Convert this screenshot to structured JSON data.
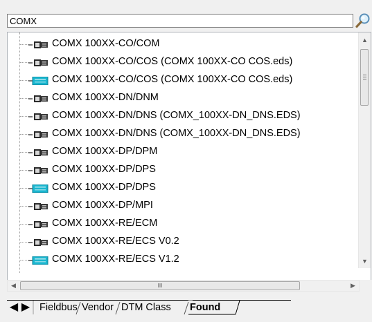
{
  "search": {
    "value": "COMX",
    "button_icon": "magnifier-icon"
  },
  "tree": {
    "items": [
      {
        "label": "COMX 100XX-CO/COM",
        "icon": "device-card-icon",
        "selected": true
      },
      {
        "label": "COMX 100XX-CO/COS (COMX 100XX-CO COS.eds)",
        "icon": "device-card-icon"
      },
      {
        "label": "COMX 100XX-CO/COS (COMX 100XX-CO COS.eds)",
        "icon": "device-card-cyan-icon"
      },
      {
        "label": "COMX 100XX-DN/DNM",
        "icon": "device-card-icon"
      },
      {
        "label": "COMX 100XX-DN/DNS (COMX_100XX-DN_DNS.EDS)",
        "icon": "device-card-icon"
      },
      {
        "label": "COMX 100XX-DN/DNS (COMX_100XX-DN_DNS.EDS)",
        "icon": "device-card-icon"
      },
      {
        "label": "COMX 100XX-DP/DPM",
        "icon": "device-card-icon"
      },
      {
        "label": "COMX 100XX-DP/DPS",
        "icon": "device-card-icon"
      },
      {
        "label": "COMX 100XX-DP/DPS",
        "icon": "device-card-cyan-icon"
      },
      {
        "label": "COMX 100XX-DP/MPI",
        "icon": "device-card-icon"
      },
      {
        "label": "COMX 100XX-RE/ECM",
        "icon": "device-card-icon"
      },
      {
        "label": "COMX 100XX-RE/ECS V0.2",
        "icon": "device-card-icon"
      },
      {
        "label": "COMX 100XX-RE/ECS V1.2",
        "icon": "device-card-cyan-icon"
      }
    ]
  },
  "scrollbars": {
    "hthumb_grip": "III"
  },
  "tabs": [
    {
      "label": "Fieldbus",
      "active": false
    },
    {
      "label": "Vendor",
      "active": false
    },
    {
      "label": "DTM Class",
      "active": false
    },
    {
      "label": "Found",
      "active": true
    }
  ],
  "colors": {
    "panel_bg": "#f0f0f0",
    "tree_line": "#a0a0a0",
    "icon_dark": "#2b2b2b",
    "icon_cyan": "#19b6cf"
  }
}
